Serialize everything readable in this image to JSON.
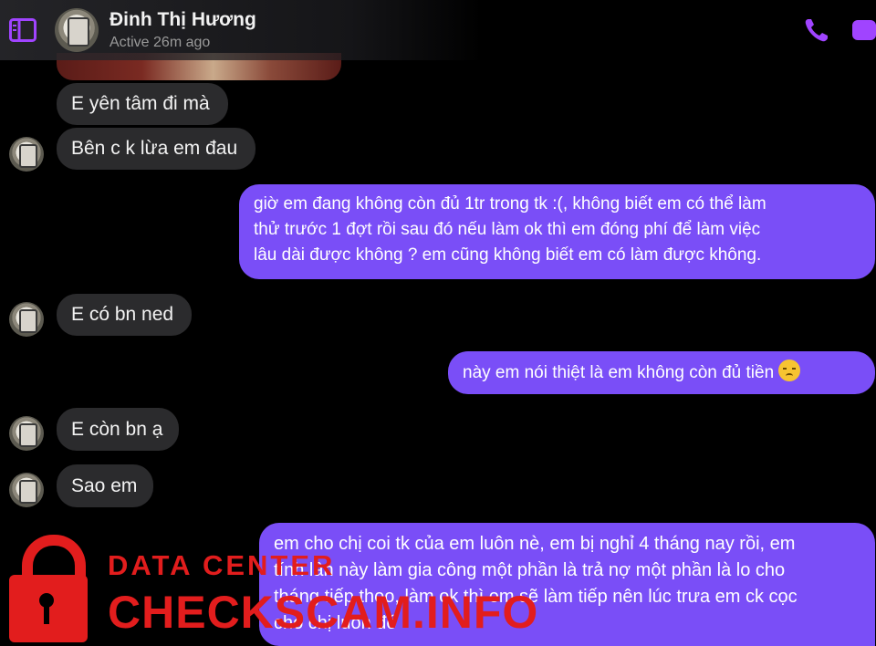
{
  "header": {
    "contact_name": "Đinh Thị Hương",
    "status": "Active 26m ago",
    "icons": [
      "sidebar-icon",
      "phone-icon",
      "video-icon"
    ],
    "accent_color": "#a044ff"
  },
  "messages": [
    {
      "from": "contact",
      "text": "E yên tâm đi mà"
    },
    {
      "from": "contact",
      "text": "Bên c k lừa em đau"
    },
    {
      "from": "me",
      "lines": [
        "giờ em đang không còn đủ 1tr trong tk :(, không biết em có thể làm",
        "thử trước 1 đợt rồi sau đó nếu làm ok thì em đóng phí để làm việc",
        "lâu dài được không ? em cũng không biết em có làm được không."
      ]
    },
    {
      "from": "contact",
      "text": "E có bn ned"
    },
    {
      "from": "me",
      "text": "này em nói thiệt là em không còn đủ tiền",
      "emoji": "disappointed-face-emoji"
    },
    {
      "from": "contact",
      "text": "E còn bn ạ"
    },
    {
      "from": "contact",
      "text": "Sao em"
    },
    {
      "from": "me",
      "lines": [
        "em cho chị coi tk của em luôn nè, em bị nghỉ 4 tháng nay rồi, em",
        "tính lần này làm gia công một phần là trả nợ một phần là lo cho",
        "tháng tiếp theo, làm ok thì em sẽ làm tiếp nên lúc trưa em ck cọc",
        "cho chị luôn đó"
      ]
    }
  ],
  "watermark": {
    "line1": "DATA CENTER",
    "line2": "CHECKSCAM.INFO",
    "color": "#e21d1d"
  },
  "colors": {
    "incoming_bubble": "#2b2b2d",
    "outgoing_bubble": "#7a4ef7",
    "background": "#000000"
  }
}
